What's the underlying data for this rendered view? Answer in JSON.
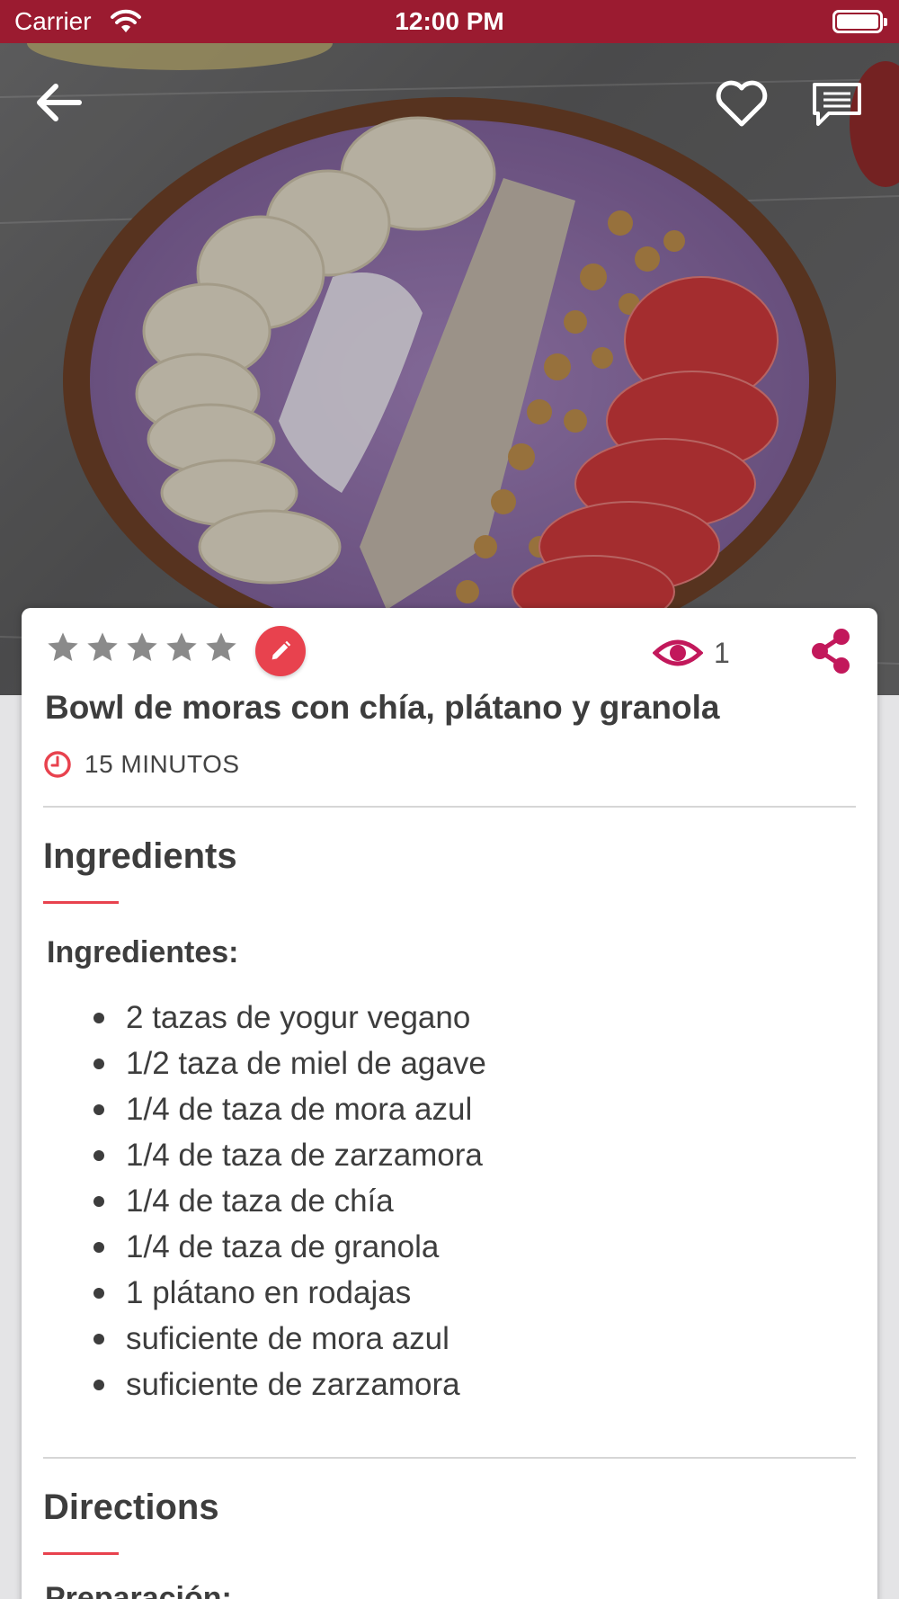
{
  "status_bar": {
    "carrier": "Carrier",
    "time": "12:00 PM"
  },
  "recipe": {
    "title": "Bowl de moras con chía, plátano y granola",
    "time": "15 MINUTOS",
    "rating": 0,
    "rating_max": 5,
    "views": "1"
  },
  "sections": {
    "ingredients_title": "Ingredients",
    "ingredients_subheading": "Ingredientes:",
    "ingredients": [
      "2 tazas de yogur vegano",
      "1/2 taza de miel de agave",
      "1/4 de taza de mora azul",
      "1/4 de taza de zarzamora",
      "1/4 de taza de chía",
      "1/4 de taza de granola",
      "1 plátano en rodajas",
      "suficiente de mora azul",
      "suficiente de zarzamora"
    ],
    "directions_title": "Directions",
    "directions_subheading": "Preparación:"
  },
  "colors": {
    "status_bar": "#9b1b30",
    "accent": "#e8424e",
    "eye": "#c2185b",
    "star_empty": "#8a8a8a"
  },
  "icons": [
    "back-arrow-icon",
    "heart-outline-icon",
    "comment-icon",
    "star-icon",
    "pencil-icon",
    "eye-icon",
    "share-icon",
    "clock-icon"
  ]
}
